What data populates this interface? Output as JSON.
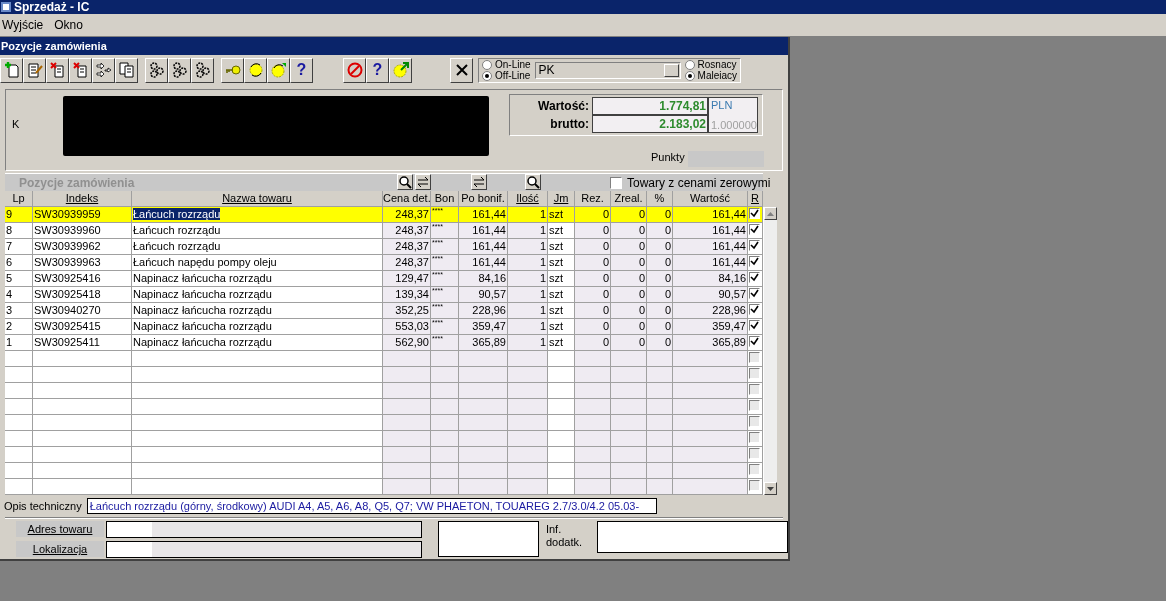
{
  "window": {
    "title": "Sprzedaż - IC"
  },
  "menu": [
    {
      "label": "Wyjście"
    },
    {
      "label": "Okno"
    }
  ],
  "child_window": {
    "title": "Pozycje zamówienia"
  },
  "toolbar": {
    "help_buttons": [
      {
        "label": "?"
      },
      {
        "label": "?"
      }
    ]
  },
  "mode": {
    "options": [
      {
        "label": "On-Line",
        "selected": false
      },
      {
        "label": "Off-Line",
        "selected": true
      }
    ]
  },
  "document_type": {
    "value": "PK"
  },
  "sort": {
    "options": [
      {
        "label": "Rosnacy",
        "selected": false
      },
      {
        "label": "Maleiacy",
        "selected": true
      }
    ]
  },
  "customer": {
    "label": "K"
  },
  "totals": {
    "net_label": "Wartość:",
    "net": "1.774,81",
    "gross_label": "brutto:",
    "gross": "2.183,02",
    "currency": "PLN",
    "rate": "1.000000"
  },
  "points": {
    "label": "Punkty"
  },
  "grid": {
    "title": "Pozycje zamówienia",
    "zero_price_filter": {
      "label": "Towary z cenami zerowymi",
      "checked": false
    },
    "columns": [
      {
        "label": "Lp",
        "sortable": false
      },
      {
        "label": "Indeks",
        "sortable": true
      },
      {
        "label": "Nazwa towaru",
        "sortable": true
      },
      {
        "label": "Cena det.",
        "sortable": false
      },
      {
        "label": "Bon",
        "sortable": false
      },
      {
        "label": "Po bonif.",
        "sortable": false
      },
      {
        "label": "Ilość",
        "sortable": true
      },
      {
        "label": "Jm",
        "sortable": true
      },
      {
        "label": "Rez.",
        "sortable": false
      },
      {
        "label": "Zreal.",
        "sortable": false
      },
      {
        "label": "%",
        "sortable": false
      },
      {
        "label": "Wartość",
        "sortable": false
      },
      {
        "label": "R",
        "sortable": true
      }
    ],
    "rows": [
      {
        "lp": "9",
        "index": "SW30939959",
        "name": "Łańcuch rozrządu",
        "price": "248,37",
        "bon": "****",
        "after_discount": "161,44",
        "qty": "1",
        "unit": "szt",
        "rez": "0",
        "zreal": "0",
        "pct": "0",
        "value": "161,44",
        "r_checked": true,
        "selected": true
      },
      {
        "lp": "8",
        "index": "SW30939960",
        "name": "Łańcuch rozrządu",
        "price": "248,37",
        "bon": "****",
        "after_discount": "161,44",
        "qty": "1",
        "unit": "szt",
        "rez": "0",
        "zreal": "0",
        "pct": "0",
        "value": "161,44",
        "r_checked": true,
        "selected": false
      },
      {
        "lp": "7",
        "index": "SW30939962",
        "name": "Łańcuch rozrządu",
        "price": "248,37",
        "bon": "****",
        "after_discount": "161,44",
        "qty": "1",
        "unit": "szt",
        "rez": "0",
        "zreal": "0",
        "pct": "0",
        "value": "161,44",
        "r_checked": true,
        "selected": false
      },
      {
        "lp": "6",
        "index": "SW30939963",
        "name": "Łańcuch napędu pompy oleju",
        "price": "248,37",
        "bon": "****",
        "after_discount": "161,44",
        "qty": "1",
        "unit": "szt",
        "rez": "0",
        "zreal": "0",
        "pct": "0",
        "value": "161,44",
        "r_checked": true,
        "selected": false
      },
      {
        "lp": "5",
        "index": "SW30925416",
        "name": "Napinacz łańcucha rozrządu",
        "price": "129,47",
        "bon": "****",
        "after_discount": "84,16",
        "qty": "1",
        "unit": "szt",
        "rez": "0",
        "zreal": "0",
        "pct": "0",
        "value": "84,16",
        "r_checked": true,
        "selected": false
      },
      {
        "lp": "4",
        "index": "SW30925418",
        "name": "Napinacz łańcucha rozrządu",
        "price": "139,34",
        "bon": "****",
        "after_discount": "90,57",
        "qty": "1",
        "unit": "szt",
        "rez": "0",
        "zreal": "0",
        "pct": "0",
        "value": "90,57",
        "r_checked": true,
        "selected": false
      },
      {
        "lp": "3",
        "index": "SW30940270",
        "name": "Napinacz łańcucha rozrządu",
        "price": "352,25",
        "bon": "****",
        "after_discount": "228,96",
        "qty": "1",
        "unit": "szt",
        "rez": "0",
        "zreal": "0",
        "pct": "0",
        "value": "228,96",
        "r_checked": true,
        "selected": false
      },
      {
        "lp": "2",
        "index": "SW30925415",
        "name": "Napinacz łańcucha rozrządu",
        "price": "553,03",
        "bon": "****",
        "after_discount": "359,47",
        "qty": "1",
        "unit": "szt",
        "rez": "0",
        "zreal": "0",
        "pct": "0",
        "value": "359,47",
        "r_checked": true,
        "selected": false
      },
      {
        "lp": "1",
        "index": "SW30925411",
        "name": "Napinacz łańcucha rozrządu",
        "price": "562,90",
        "bon": "****",
        "after_discount": "365,89",
        "qty": "1",
        "unit": "szt",
        "rez": "0",
        "zreal": "0",
        "pct": "0",
        "value": "365,89",
        "r_checked": true,
        "selected": false
      }
    ],
    "empty_rows": [
      {
        "r_checked": false
      },
      {
        "r_checked": false
      },
      {
        "r_checked": false
      },
      {
        "r_checked": false
      },
      {
        "r_checked": false
      },
      {
        "r_checked": false
      },
      {
        "r_checked": false
      },
      {
        "r_checked": false
      },
      {
        "r_checked": false
      }
    ]
  },
  "description": {
    "label": "Opis techniczny",
    "value": "Łańcuch rozrządu (górny, środkowy) AUDI A4, A5, A6, A8, Q5, Q7; VW PHAETON, TOUAREG 2.7/3.0/4.2 05.03-"
  },
  "bottom": {
    "address_label": "Adres towaru",
    "location_label": "Lokalizacja",
    "info_label": "Inf. dodatk."
  }
}
